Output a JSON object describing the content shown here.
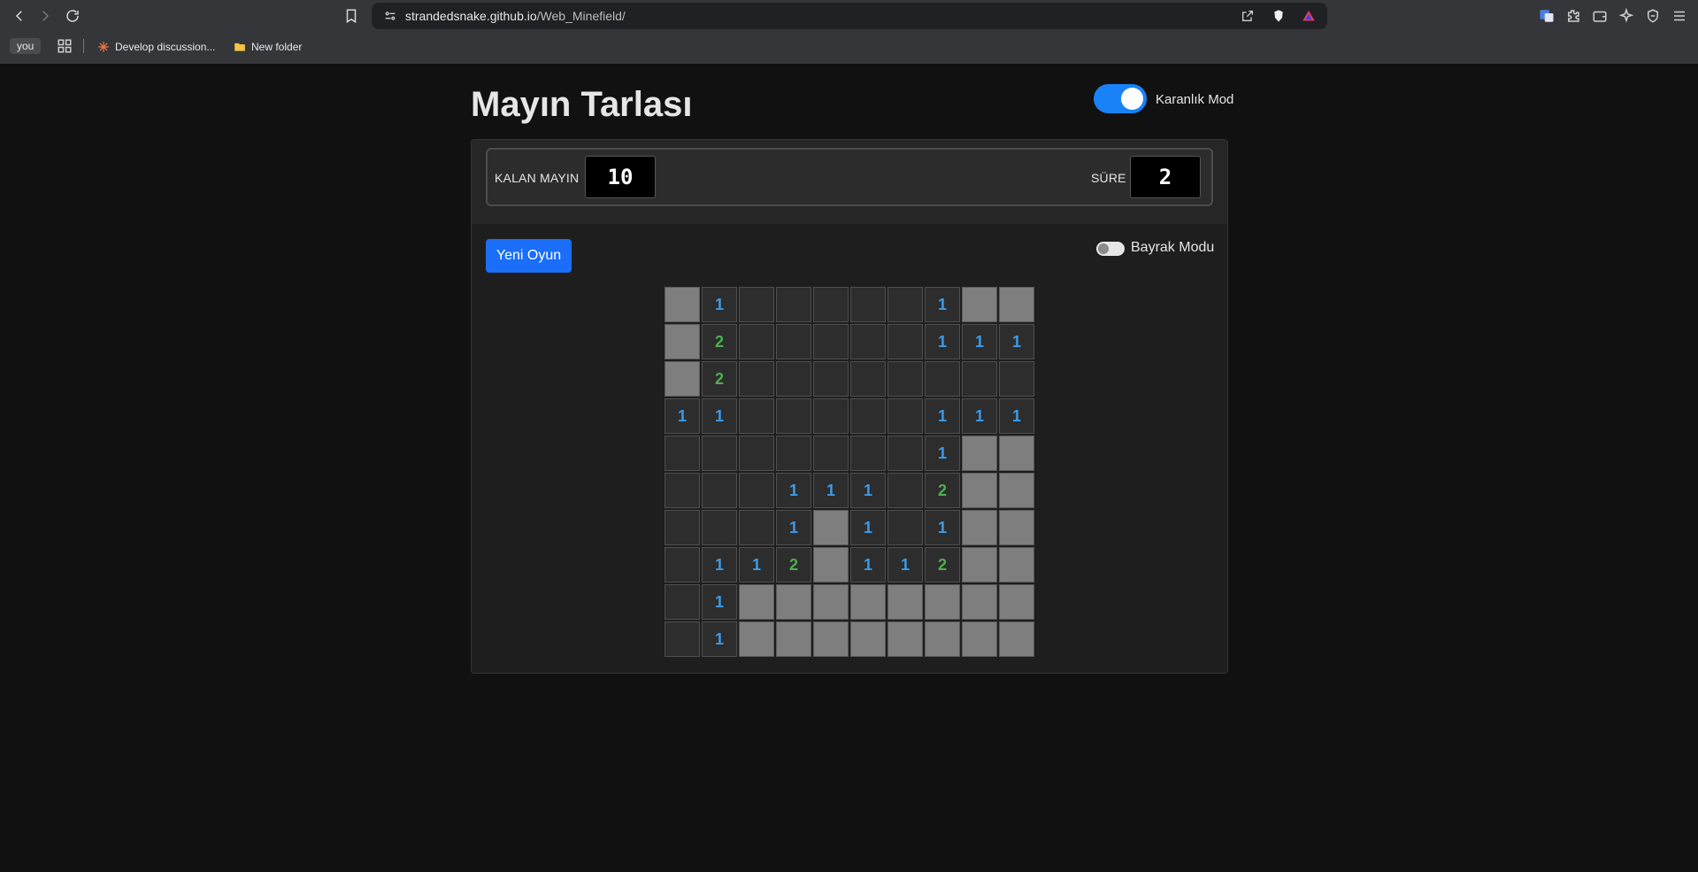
{
  "browser": {
    "url_host": "strandedsnake.github.io",
    "url_path": "/Web_Minefield/",
    "bookmarks": {
      "profile": "you",
      "items": [
        {
          "label": "Develop discussion..."
        },
        {
          "label": "New folder"
        }
      ]
    }
  },
  "page": {
    "title": "Mayın Tarlası",
    "dark_mode": {
      "label": "Karanlık Mod",
      "on": true
    },
    "remaining_mines": {
      "label": "KALAN MAYIN",
      "value": "10"
    },
    "time": {
      "label": "SÜRE",
      "value": "2"
    },
    "new_game_label": "Yeni Oyun",
    "flag_mode": {
      "label": "Bayrak Modu",
      "on": false
    }
  },
  "colors": {
    "accent": "#1a82f7",
    "button": "#1a6ef7",
    "number_1": "#3b9be8",
    "number_2": "#4cb050",
    "closed_cell": "#7e7e7e",
    "open_cell": "#2d2d2d"
  },
  "board": {
    "legend": "# = unopened, . = opened empty, digit = adjacent mine count",
    "rows": [
      "#1.....1##",
      "#2.....111",
      "#2........",
      "11.....111",
      ".......1##",
      "...111.2##",
      "...1#1.1##",
      ".112#112##",
      ".1########",
      ".1########"
    ]
  }
}
